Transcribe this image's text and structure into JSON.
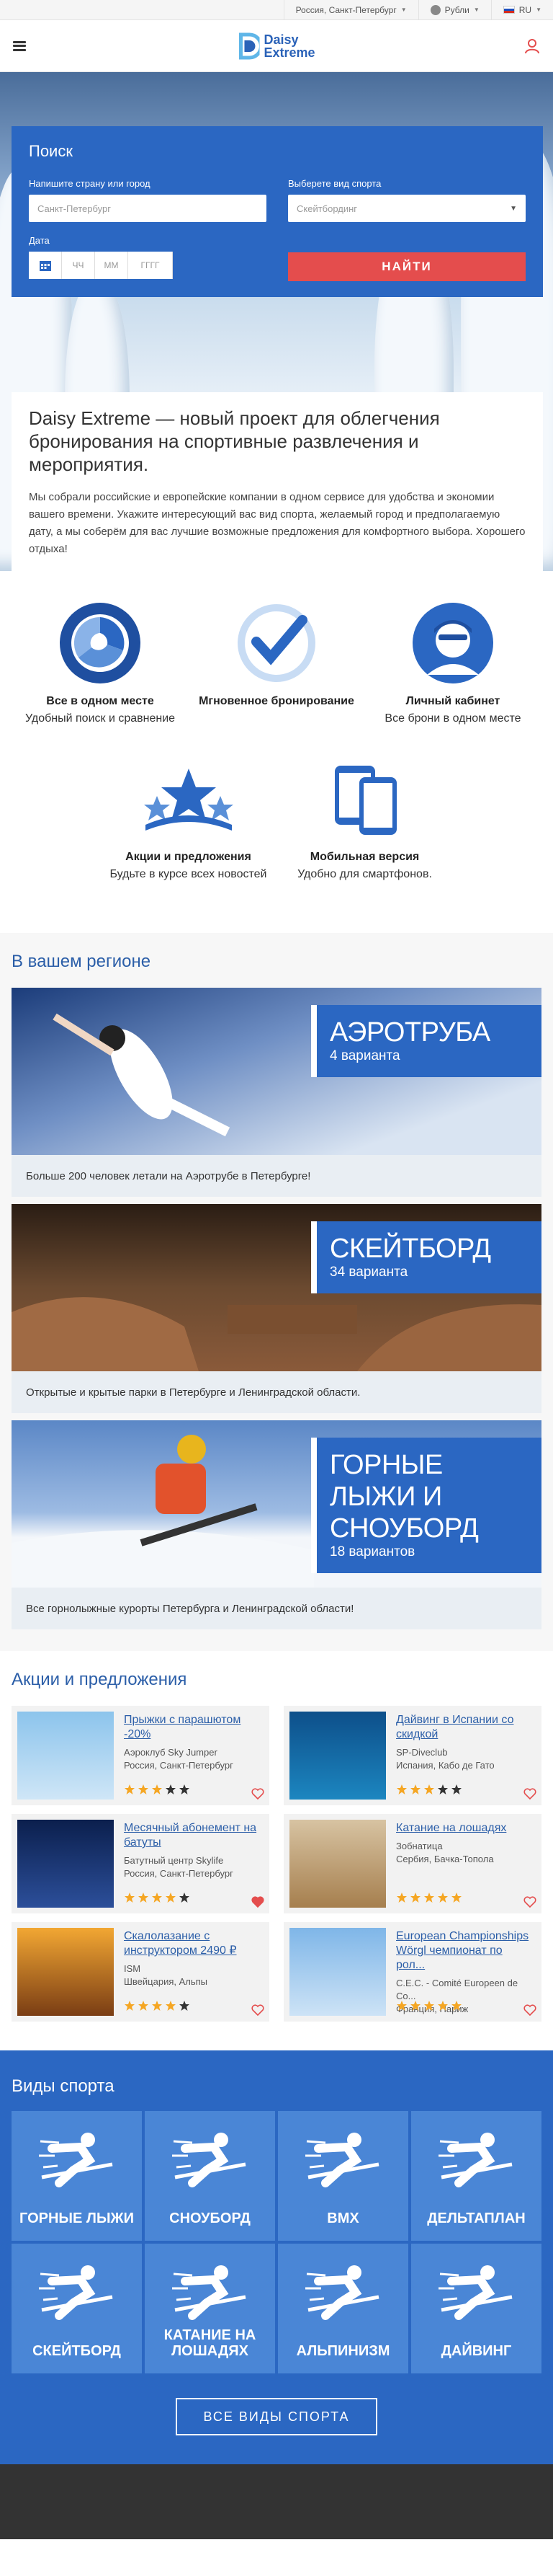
{
  "topbar": {
    "location": "Россия, Санкт-Петербург",
    "currency": "Рубли",
    "language": "RU"
  },
  "header": {
    "logo_line1": "Daisy",
    "logo_line2": "Extreme"
  },
  "search": {
    "title": "Поиск",
    "place_label": "Напишите страну или город",
    "place_value": "Санкт-Петербург",
    "sport_label": "Выберете вид спорта",
    "sport_value": "Скейтбординг",
    "date_label": "Дата",
    "day": "ЧЧ",
    "month": "ММ",
    "year": "ГГГГ",
    "button": "НАЙТИ"
  },
  "intro": {
    "title": "Daisy Extreme — новый проект для облегчения бронирования на спортивные развлечения и мероприятия.",
    "text": "Мы собрали российские и европейские компании в одном сервисе для удобства и экономии вашего времени. Укажите интересующий вас вид спорта, желаемый город и предполагаемую дату, а мы соберём для вас лучшие возможные предложения для комфортного выбора. Хорошего отдыха!"
  },
  "features": [
    {
      "title": "Все в одном месте",
      "text": "Удобный поиск и сравнение"
    },
    {
      "title": "Мгновенное бронирование",
      "text": ""
    },
    {
      "title": "Личный кабинет",
      "text": "Все брони в одном месте"
    },
    {
      "title": "Акции и предложения",
      "text": "Будьте в курсе всех новостей"
    },
    {
      "title": "Мобильная версия",
      "text": "Удобно для смартфонов."
    }
  ],
  "region": {
    "title": "В вашем регионе",
    "cards": [
      {
        "name": "АЭРОТРУБА",
        "count": "4 варианта",
        "desc": "Больше 200 человек летали на Аэротрубе в Петербурге!"
      },
      {
        "name": "СКЕЙТБОРД",
        "count": "34 варианта",
        "desc": "Открытые и крытые парки в Петербурге и Ленинградской области."
      },
      {
        "name": "ГОРНЫЕ ЛЫЖИ И СНОУБОРД",
        "count": "18 вариантов",
        "desc": "Все горнолыжные курорты Петербурга и Ленинградской области!"
      }
    ]
  },
  "promo": {
    "title": "Акции и предложения",
    "items": [
      {
        "title": "Прыжки с парашютом -20%",
        "org": "Аэроклуб Sky Jumper",
        "place": "Россия, Санкт-Петербург",
        "rating": 3,
        "liked": false
      },
      {
        "title": "Дайвинг в Испании со скидкой",
        "org": "SP-Diveclub",
        "place": "Испания, Кабо де Гато",
        "rating": 3,
        "liked": false
      },
      {
        "title": "Месячный абонемент на батуты",
        "org": "Батутный центр Skylife",
        "place": "Россия, Санкт-Петербург",
        "rating": 4,
        "liked": true
      },
      {
        "title": "Катание на лошадях",
        "org": "Зобнатица",
        "place": "Сербия, Бачка-Топола",
        "rating": 5,
        "liked": false
      },
      {
        "title": "Скалолазание с инструктором 2490 ₽",
        "org": "ISM",
        "place": "Швейцария, Альпы",
        "rating": 4,
        "liked": false
      },
      {
        "title": "European Championships Wörgl чемпионат по рол...",
        "org": "C.E.C. - Comité Europeen de Co...",
        "place": "Франция, Париж",
        "rating": 5,
        "liked": false
      }
    ]
  },
  "sports": {
    "title": "Виды спорта",
    "items": [
      "ГОРНЫЕ ЛЫЖИ",
      "СНОУБОРД",
      "BMX",
      "ДЕЛЬТАПЛАН",
      "СКЕЙТБОРД",
      "КАТАНИЕ НА ЛОШАДЯХ",
      "АЛЬПИНИЗМ",
      "ДАЙВИНГ"
    ],
    "button": "ВСЕ ВИДЫ СПОРТА"
  },
  "colors": {
    "primary": "#2b67c2",
    "accent": "#e44d4d",
    "star": "#f5a623"
  }
}
